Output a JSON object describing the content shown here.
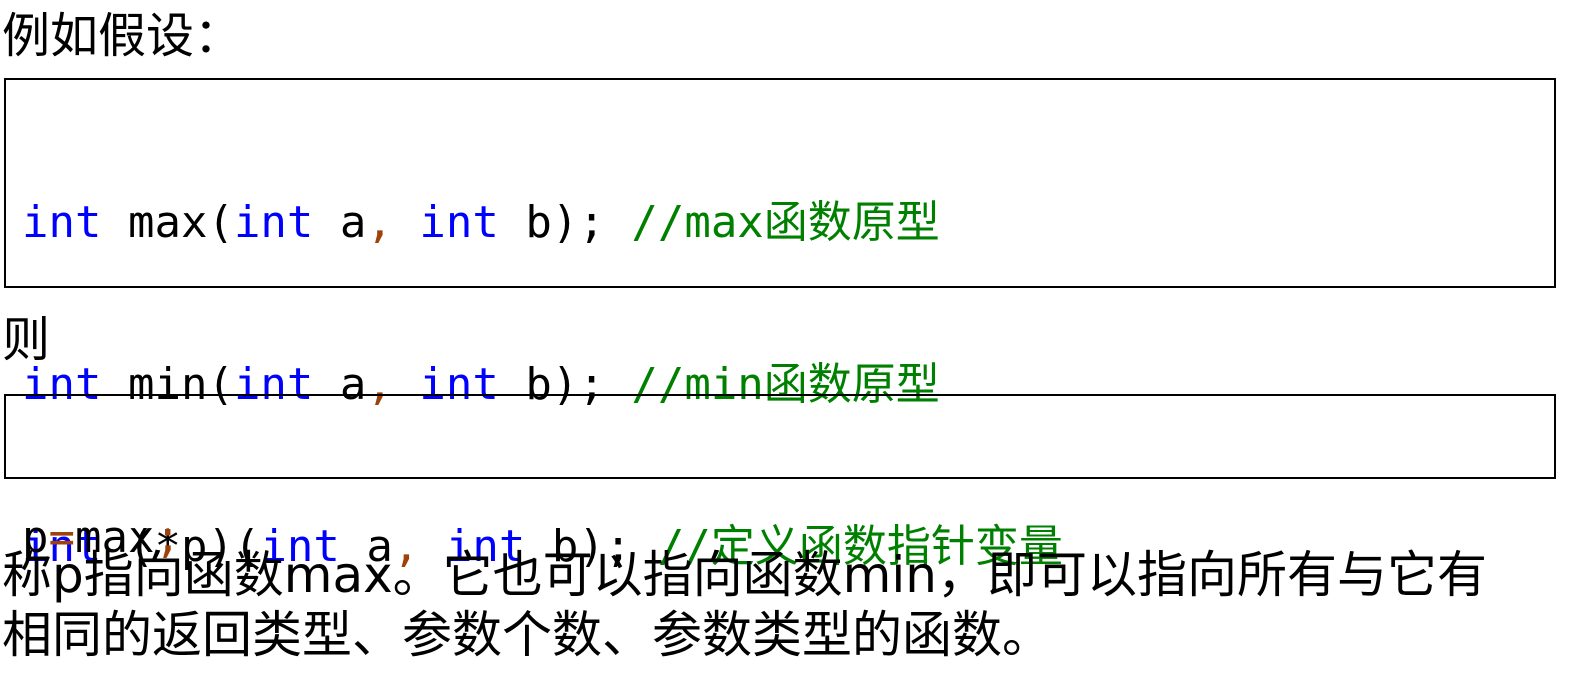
{
  "intro": "例如假设：",
  "code_block_1": [
    [
      {
        "t": "int",
        "c": "kw"
      },
      {
        "t": " max(",
        "c": "pl"
      },
      {
        "t": "int",
        "c": "kw"
      },
      {
        "t": " a",
        "c": "pl"
      },
      {
        "t": ",",
        "c": "pn"
      },
      {
        "t": " ",
        "c": "pl"
      },
      {
        "t": "int",
        "c": "kw"
      },
      {
        "t": " b); ",
        "c": "pl"
      },
      {
        "t": "//max函数原型",
        "c": "cm"
      }
    ],
    [
      {
        "t": "int",
        "c": "kw"
      },
      {
        "t": " min(",
        "c": "pl"
      },
      {
        "t": "int",
        "c": "kw"
      },
      {
        "t": " a",
        "c": "pl"
      },
      {
        "t": ",",
        "c": "pn"
      },
      {
        "t": " ",
        "c": "pl"
      },
      {
        "t": "int",
        "c": "kw"
      },
      {
        "t": " b); ",
        "c": "pl"
      },
      {
        "t": "//min函数原型",
        "c": "cm"
      }
    ],
    [
      {
        "t": "int",
        "c": "kw"
      },
      {
        "t": " (*p)(",
        "c": "pl"
      },
      {
        "t": "int",
        "c": "kw"
      },
      {
        "t": " a",
        "c": "pl"
      },
      {
        "t": ",",
        "c": "pn"
      },
      {
        "t": " ",
        "c": "pl"
      },
      {
        "t": "int",
        "c": "kw"
      },
      {
        "t": " b); ",
        "c": "pl"
      },
      {
        "t": "//定义函数指针变量",
        "c": "cm"
      }
    ]
  ],
  "then": "则",
  "code_block_2": [
    [
      {
        "t": "p",
        "c": "pl"
      },
      {
        "t": "=",
        "c": "pn"
      },
      {
        "t": "max",
        "c": "pl"
      },
      {
        "t": ";",
        "c": "pn"
      }
    ]
  ],
  "paragraph": {
    "line1": "称p指向函数max。它也可以指向函数min，即可以指向所有与它有",
    "line2": "相同的返回类型、参数个数、参数类型的函数。"
  },
  "colors": {
    "keyword": "#0000ff",
    "comment": "#008000",
    "punctuation": "#a0410a",
    "text": "#000000"
  }
}
